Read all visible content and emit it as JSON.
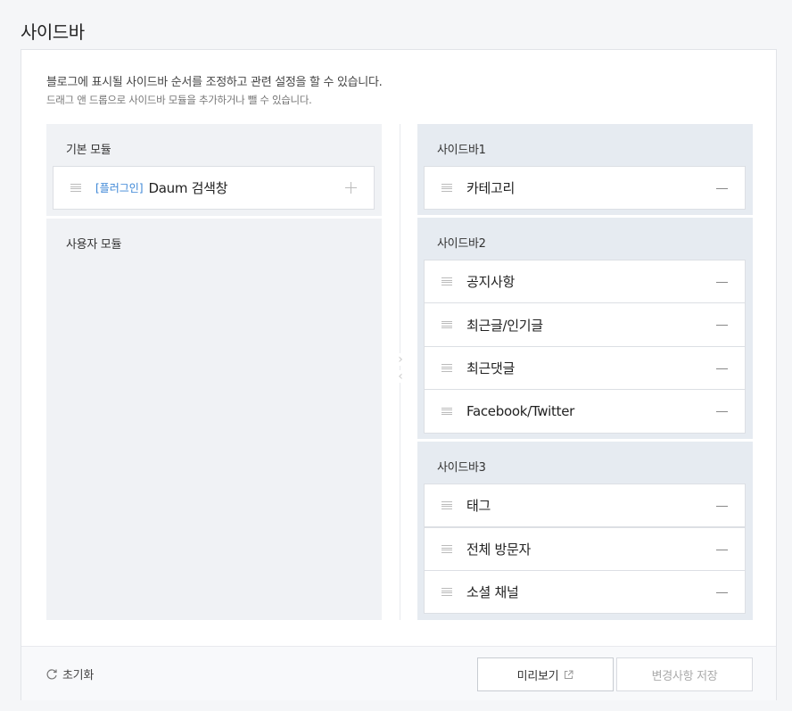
{
  "page_title": "사이드바",
  "description": {
    "line1": "블로그에 표시될 사이드바 순서를 조정하고 관련 설정을 할 수 있습니다.",
    "line2": "드래그 앤 드롭으로 사이드바 모듈을 추가하거나 뺄 수 있습니다."
  },
  "left": {
    "basic_title": "기본 모듈",
    "basic_items": [
      {
        "tag": "[플러그인]",
        "label": "Daum 검색창",
        "icon": "plus-icon"
      }
    ],
    "user_title": "사용자 모듈"
  },
  "arrows": {
    "right": "›",
    "left": "‹"
  },
  "sidebars": [
    {
      "title": "사이드바1",
      "items": [
        {
          "label": "카테고리"
        }
      ]
    },
    {
      "title": "사이드바2",
      "items": [
        {
          "label": "공지사항"
        },
        {
          "label": "최근글/인기글"
        },
        {
          "label": "최근댓글"
        },
        {
          "label": "Facebook/Twitter"
        }
      ]
    },
    {
      "title": "사이드바3",
      "items": [
        {
          "label": "태그"
        },
        {
          "label": "전체 방문자"
        },
        {
          "label": "소셜 채널"
        }
      ]
    }
  ],
  "footer": {
    "reset_label": "초기화",
    "preview_label": "미리보기",
    "save_label": "변경사항 저장"
  },
  "colors": {
    "plugin_tag": "#3b86d6",
    "sidebar_bg": "#e6ebf1",
    "module_bg": "#f0f2f5"
  }
}
